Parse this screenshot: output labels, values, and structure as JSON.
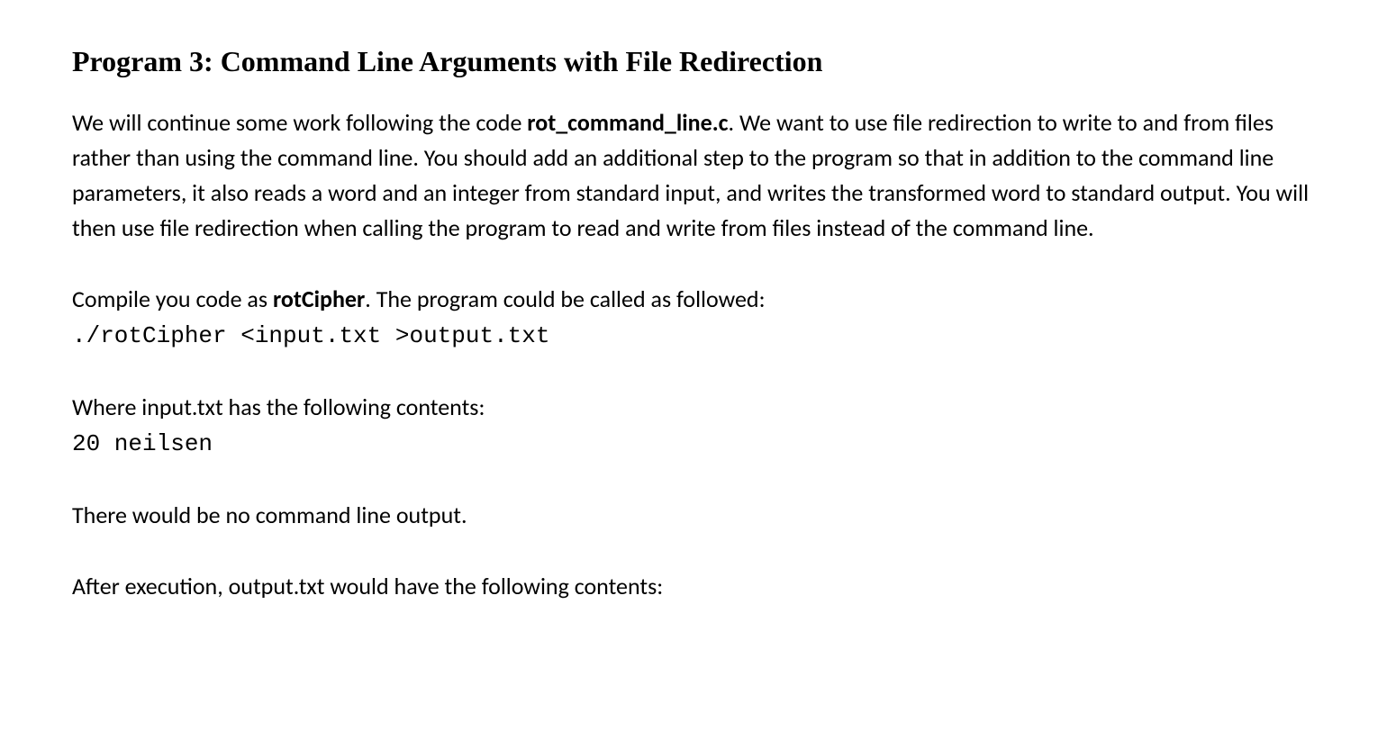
{
  "heading": "Program 3: Command Line Arguments with File Redirection",
  "para1_part1": "We will continue some work following the code ",
  "para1_bold1": "rot_command_line.c",
  "para1_part2": ". We want to use file redirection to write to and from files rather than using the command line.  You should add an additional step to the program so that in addition to the command line parameters, it also reads a word and an integer from standard input, and writes the transformed word to standard output.  You will then use file redirection when calling the program to read and write from files instead of the command line.",
  "para2_part1": "Compile you code as ",
  "para2_bold1": "rotCipher",
  "para2_part2": ". The program could be called as followed:",
  "code1": "./rotCipher <input.txt >output.txt",
  "para3": "Where input.txt has the following contents:",
  "code2": "20 neilsen",
  "para4": "There would be no command line output.",
  "para5": "After execution, output.txt would have the following contents:"
}
